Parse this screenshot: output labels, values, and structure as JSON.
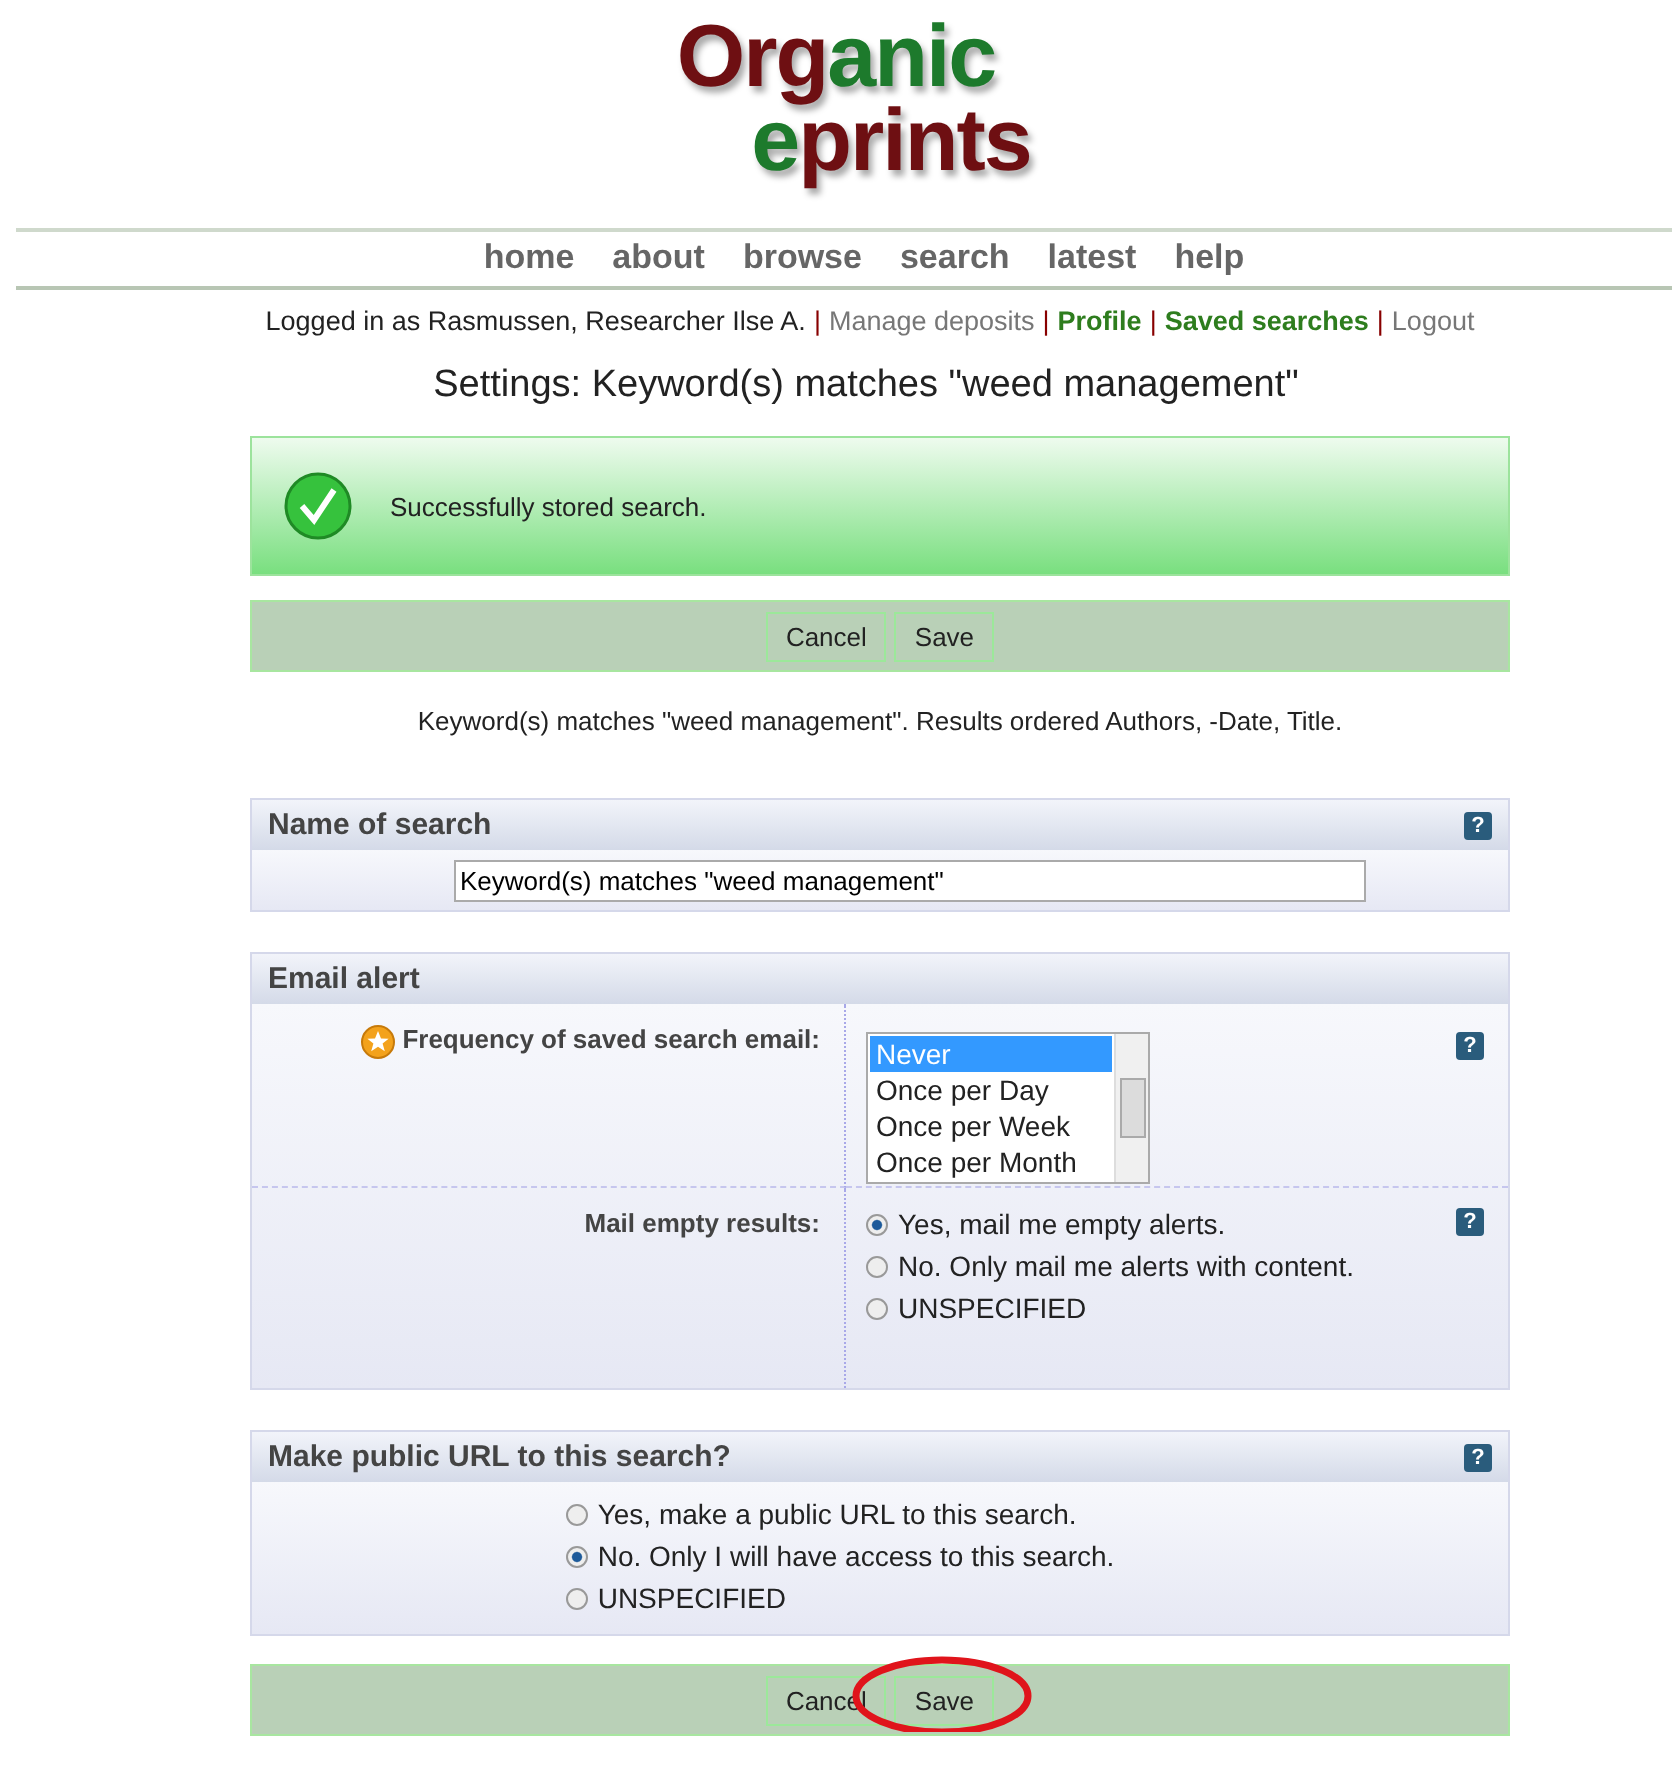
{
  "logo": {
    "lines": [
      [
        {
          "text": "Org",
          "color": "#6e0f12"
        },
        {
          "text": "anic",
          "color": "#1d7a2c"
        }
      ],
      [
        {
          "text": "e",
          "color": "#1d7a2c"
        },
        {
          "text": "prints",
          "color": "#6e0f12"
        }
      ]
    ]
  },
  "nav": [
    "home",
    "about",
    "browse",
    "search",
    "latest",
    "help"
  ],
  "user_bar": {
    "text": "Logged in as Rasmussen, Researcher Ilse A.",
    "separator": "|",
    "links": [
      {
        "label": "Manage deposits",
        "highlighted": false
      },
      {
        "label": "Profile",
        "highlighted": true
      },
      {
        "label": "Saved searches",
        "highlighted": true
      },
      {
        "label": "Logout",
        "highlighted": false
      }
    ]
  },
  "page_title": "Settings: Keyword(s) matches \"weed management\"",
  "message": {
    "text": "Successfully stored search."
  },
  "top_buttons": [
    {
      "label": "Cancel"
    },
    {
      "label": "Save"
    }
  ],
  "summary": "Keyword(s) matches \"weed management\". Results ordered Authors, -Date, Title.",
  "name_section": {
    "title": "Name of search",
    "help": "?",
    "value": "Keyword(s) matches \"weed management\""
  },
  "email_section": {
    "title": "Email alert",
    "frequency": {
      "label": "Frequency of saved search email:",
      "required": true,
      "help": "?",
      "options": [
        {
          "label": "Never",
          "selected": true
        },
        {
          "label": "Once per Day",
          "selected": false
        },
        {
          "label": "Once per Week",
          "selected": false
        },
        {
          "label": "Once per Month",
          "selected": false
        }
      ]
    },
    "empty": {
      "label": "Mail empty results:",
      "help": "?",
      "options": [
        {
          "label": "Yes, mail me empty alerts.",
          "selected": true
        },
        {
          "label": "No. Only mail me alerts with content.",
          "selected": false
        },
        {
          "label": "UNSPECIFIED",
          "selected": false
        }
      ]
    }
  },
  "public_section": {
    "title": "Make public URL to this search?",
    "help": "?",
    "options": [
      {
        "label": "Yes, make a public URL to this search.",
        "selected": false
      },
      {
        "label": "No. Only I will have access to this search.",
        "selected": true
      },
      {
        "label": "UNSPECIFIED",
        "selected": false
      }
    ]
  },
  "bottom_buttons": [
    {
      "label": "Cancel",
      "circled": false
    },
    {
      "label": "Save",
      "circled": true
    }
  ]
}
